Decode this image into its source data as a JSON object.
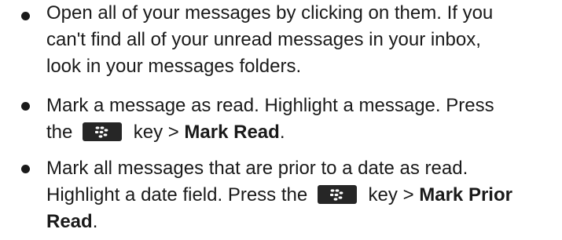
{
  "items": [
    {
      "lines": [
        "Open all of your messages by clicking on them. If you",
        "can't find all of your unread messages in your inbox,",
        "look in your messages folders."
      ]
    },
    {
      "line1": "Mark a message as read. Highlight a message. Press",
      "line2_pre": "the",
      "line2_mid": "key >",
      "line2_bold": "Mark Read",
      "line2_end": ".",
      "key_icon": "blackberry-menu-key-icon"
    },
    {
      "line1": "Mark all messages that are prior to a date as read.",
      "line2_pre": "Highlight a date field. Press the",
      "line2_mid": "key >",
      "line2_bold": "Mark Prior",
      "line3_bold": "Read",
      "line3_end": ".",
      "key_icon": "blackberry-menu-key-icon"
    }
  ]
}
